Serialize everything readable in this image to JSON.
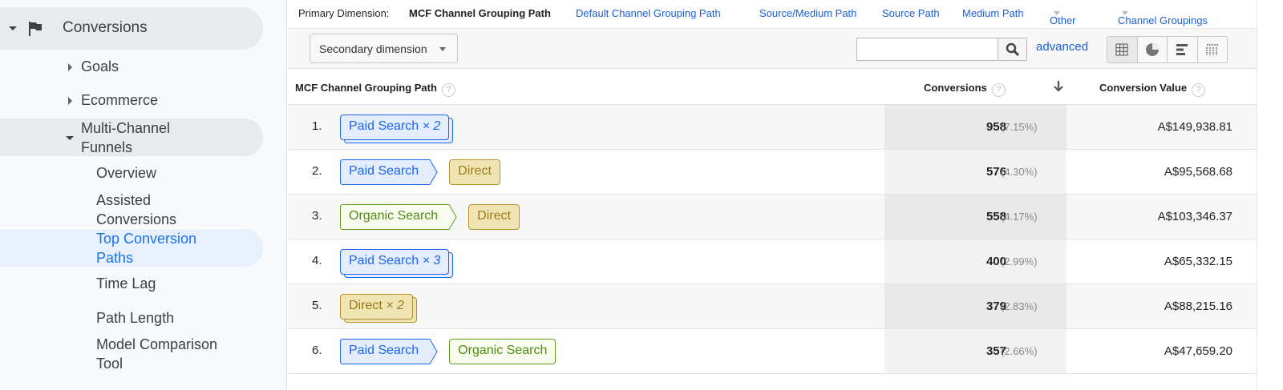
{
  "sidebar": {
    "section": "Conversions",
    "items": [
      {
        "label": "Goals"
      },
      {
        "label": "Ecommerce"
      },
      {
        "label": "Multi-Channel Funnels"
      },
      {
        "label": "Overview"
      },
      {
        "label": "Assisted Conversions"
      },
      {
        "label": "Top Conversion Paths",
        "active": true
      },
      {
        "label": "Time Lag"
      },
      {
        "label": "Path Length"
      },
      {
        "label": "Model Comparison Tool"
      }
    ]
  },
  "primary_dimension": {
    "label": "Primary Dimension:",
    "selected": "MCF Channel Grouping Path",
    "links": [
      "Default Channel Grouping Path",
      "Source/Medium Path",
      "Source Path",
      "Medium Path"
    ],
    "other": "Other",
    "channel_groupings": "Channel Groupings"
  },
  "toolbar": {
    "secondary_dimension": "Secondary dimension",
    "search_value": "",
    "advanced": "advanced",
    "views": [
      "table-view-icon",
      "pie-view-icon",
      "bar-view-icon",
      "comparison-view-icon"
    ]
  },
  "table": {
    "headers": {
      "path": "MCF Channel Grouping Path",
      "conversions": "Conversions",
      "value": "Conversion Value",
      "help": "?"
    },
    "channel_colors": {
      "Paid Search": {
        "bg": "#e3edfd",
        "border": "#1a66f0",
        "text": "#1a66f0"
      },
      "Direct": {
        "bg": "#f0e4b3",
        "border": "#b3912e",
        "text": "#9a7a1e"
      },
      "Organic Search": {
        "bg": "#f8fdf0",
        "border": "#5f9a1c",
        "text": "#4f8a10"
      }
    },
    "rows": [
      {
        "index": "1.",
        "path": [
          {
            "channel": "Paid Search",
            "repeat": "× 2"
          }
        ],
        "conversions": "958",
        "percent": "(7.15%)",
        "value": "A$149,938.81"
      },
      {
        "index": "2.",
        "path": [
          {
            "channel": "Paid Search"
          },
          {
            "channel": "Direct"
          }
        ],
        "conversions": "576",
        "percent": "(4.30%)",
        "value": "A$95,568.68"
      },
      {
        "index": "3.",
        "path": [
          {
            "channel": "Organic Search"
          },
          {
            "channel": "Direct"
          }
        ],
        "conversions": "558",
        "percent": "(4.17%)",
        "value": "A$103,346.37"
      },
      {
        "index": "4.",
        "path": [
          {
            "channel": "Paid Search",
            "repeat": "× 3"
          }
        ],
        "conversions": "400",
        "percent": "(2.99%)",
        "value": "A$65,332.15"
      },
      {
        "index": "5.",
        "path": [
          {
            "channel": "Direct",
            "repeat": "× 2"
          }
        ],
        "conversions": "379",
        "percent": "(2.83%)",
        "value": "A$88,215.16"
      },
      {
        "index": "6.",
        "path": [
          {
            "channel": "Paid Search"
          },
          {
            "channel": "Organic Search"
          }
        ],
        "conversions": "357",
        "percent": "(2.66%)",
        "value": "A$47,659.20"
      }
    ]
  }
}
